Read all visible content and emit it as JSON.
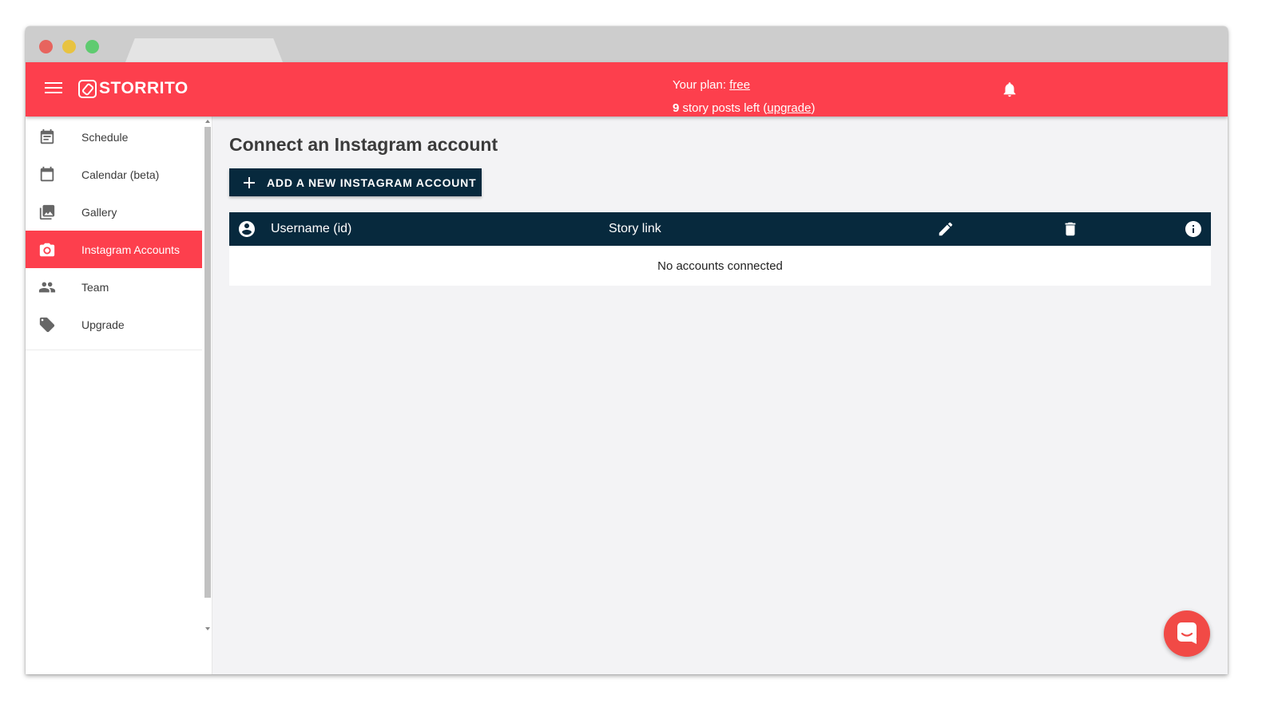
{
  "header": {
    "logo_text": "STORRITO",
    "plan_prefix": "Your plan:",
    "plan_name": "free",
    "posts_count": "9",
    "posts_text": "story posts left (",
    "upgrade_link": "upgrade",
    "posts_suffix": ")"
  },
  "sidebar": {
    "items": [
      {
        "label": "Schedule",
        "icon": "schedule-icon"
      },
      {
        "label": "Calendar (beta)",
        "icon": "calendar-icon"
      },
      {
        "label": "Gallery",
        "icon": "gallery-icon"
      },
      {
        "label": "Instagram Accounts",
        "icon": "camera-icon",
        "active": true
      },
      {
        "label": "Team",
        "icon": "team-icon"
      },
      {
        "label": "Upgrade",
        "icon": "tag-icon"
      }
    ]
  },
  "main": {
    "title": "Connect an Instagram account",
    "add_button_label": "ADD A NEW INSTAGRAM ACCOUNT",
    "table": {
      "columns": [
        "Username (id)",
        "Story link"
      ],
      "action_icons": [
        "edit-icon",
        "delete-icon",
        "info-icon"
      ],
      "empty_text": "No accounts connected"
    }
  },
  "colors": {
    "brand": "#fd3f4d",
    "dark": "#07293d",
    "chat": "#f14a46"
  }
}
